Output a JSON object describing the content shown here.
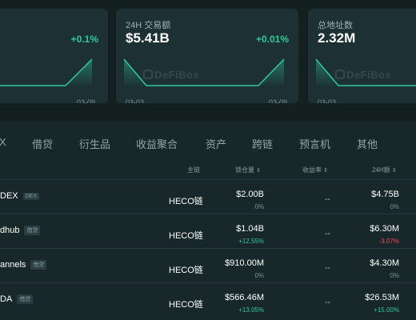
{
  "colors": {
    "positive": "#2fc99a",
    "negative": "#f0485c",
    "card": "#1d3134"
  },
  "watermark": "DeFiBox",
  "stats": [
    {
      "label": "",
      "value": "",
      "change": "+0.1%",
      "date_start": "",
      "date_end": "03-09"
    },
    {
      "label": "24H 交易额",
      "value": "$5.41B",
      "change": "+0.01%",
      "date_start": "03-03",
      "date_end": "03-09"
    },
    {
      "label": "总地址数",
      "value": "2.32M",
      "change": "",
      "date_start": "03-03",
      "date_end": ""
    }
  ],
  "tabs": [
    "X",
    "借贷",
    "衍生品",
    "收益聚合",
    "资产",
    "跨链",
    "预言机",
    "其他"
  ],
  "table": {
    "headers": {
      "chain": "主链",
      "tvl": "锁仓量",
      "yield": "收益率",
      "volume": "24H额"
    },
    "rows": [
      {
        "name": "DEX",
        "tag": "DEX",
        "chain": "HECO链",
        "tvl": "$2.00B",
        "tvl_change": "0%",
        "tvl_dir": "flat",
        "yield": "--",
        "volume": "$4.75B",
        "vol_change": "0%",
        "vol_dir": "flat"
      },
      {
        "name": "dhub",
        "tag": "借贷",
        "chain": "HECO链",
        "tvl": "$1.04B",
        "tvl_change": "+12.55%",
        "tvl_dir": "up",
        "yield": "--",
        "volume": "$6.30M",
        "vol_change": "-3.07%",
        "vol_dir": "down"
      },
      {
        "name": "annels",
        "tag": "借贷",
        "chain": "HECO链",
        "tvl": "$910.00M",
        "tvl_change": "0%",
        "tvl_dir": "flat",
        "yield": "--",
        "volume": "$4.30M",
        "vol_change": "0%",
        "vol_dir": "flat"
      },
      {
        "name": "DA",
        "tag": "借贷",
        "chain": "HECO链",
        "tvl": "$566.46M",
        "tvl_change": "+13.05%",
        "tvl_dir": "up",
        "yield": "--",
        "volume": "$26.53M",
        "vol_change": "+15.00%",
        "vol_dir": "up"
      }
    ]
  }
}
